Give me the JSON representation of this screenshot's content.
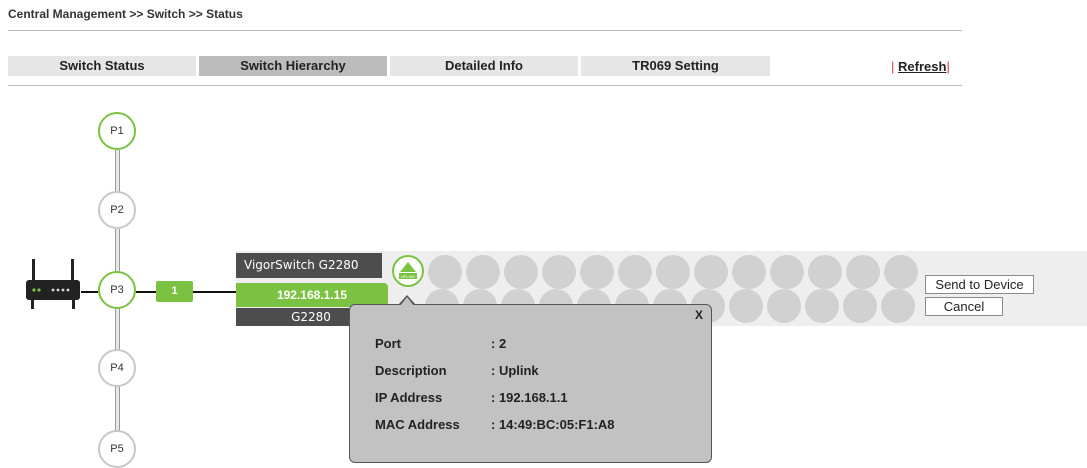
{
  "breadcrumb": "Central Management >> Switch >> Status",
  "tabs": [
    {
      "label": "Switch Status"
    },
    {
      "label": "Switch Hierarchy"
    },
    {
      "label": "Detailed Info"
    },
    {
      "label": "TR069 Setting"
    }
  ],
  "refresh": {
    "separator": "|",
    "label": "Refresh"
  },
  "hierarchy": {
    "ports": [
      {
        "label": "P1"
      },
      {
        "label": "P2"
      },
      {
        "label": "P3"
      },
      {
        "label": "P4"
      },
      {
        "label": "P5"
      }
    ],
    "link_port": "1"
  },
  "switch": {
    "name": "VigorSwitch G2280",
    "ip": "192.168.1.15",
    "model": "G2280",
    "uplink_icon_text": "UPLINK",
    "send_button": "Send to Device",
    "cancel_button": "Cancel"
  },
  "popup": {
    "close": "X",
    "rows": [
      {
        "label": "Port",
        "value": ": 2"
      },
      {
        "label": "Description",
        "value": ": Uplink"
      },
      {
        "label": "IP Address",
        "value": ": 192.168.1.1"
      },
      {
        "label": "MAC Address",
        "value": ": 14:49:BC:05:F1:A8"
      }
    ]
  },
  "colors": {
    "accent_green": "#7cc242",
    "dark_gray": "#4d4d4d",
    "active_tab": "#bcbcbc",
    "refresh_separator": "#e03a3a"
  }
}
